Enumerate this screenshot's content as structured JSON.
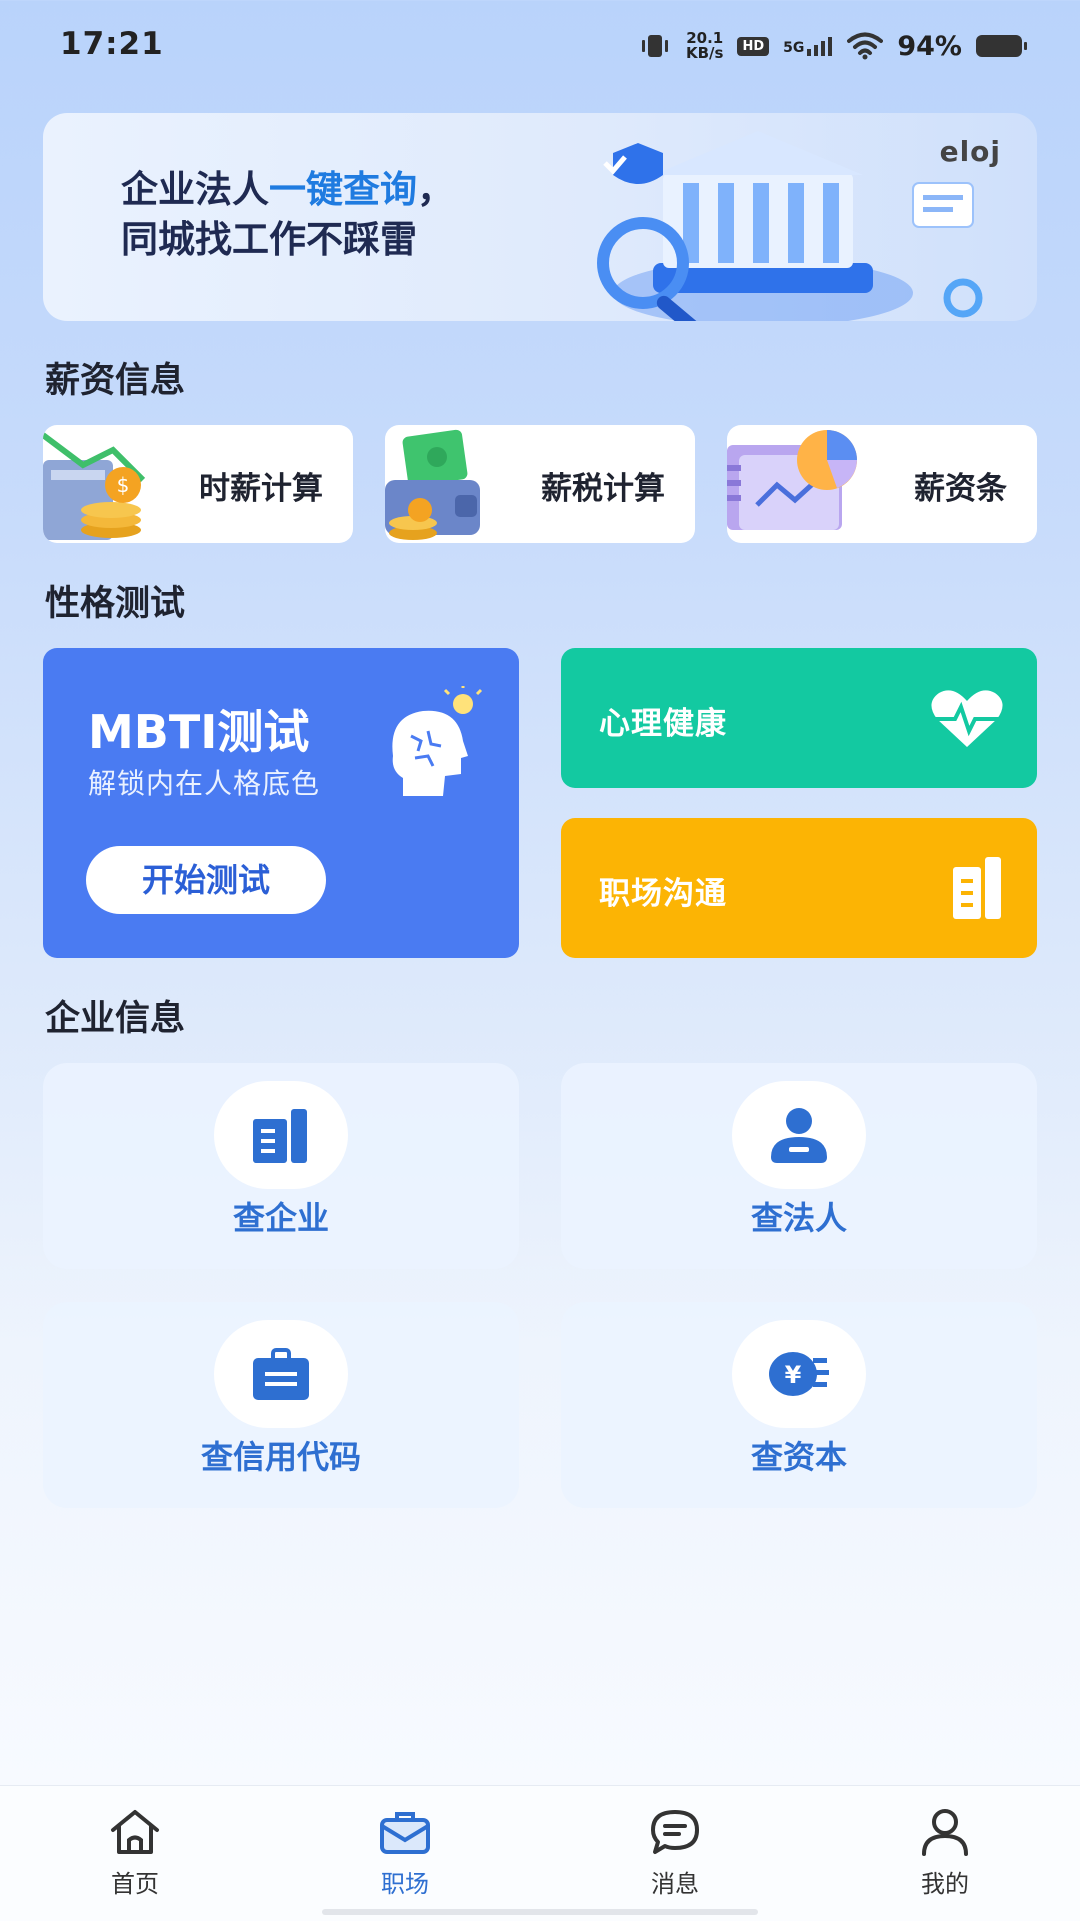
{
  "status_bar": {
    "time": "17:21",
    "net_speed_value": "20.1",
    "net_speed_unit": "KB/s",
    "hd": "HD",
    "network": "5G",
    "battery": "94%"
  },
  "banner": {
    "line1_prefix": "企业法人",
    "line1_highlight": "一键查询",
    "line1_suffix": "，",
    "line2": "同城找工作不踩雷",
    "brand": "eloj"
  },
  "salary_section": {
    "title": "薪资信息",
    "items": [
      {
        "label": "时薪计算",
        "icon": "hourly-wage-icon"
      },
      {
        "label": "薪税计算",
        "icon": "salary-tax-icon"
      },
      {
        "label": "薪资条",
        "icon": "payslip-icon"
      }
    ]
  },
  "personality_section": {
    "title": "性格测试",
    "mbti": {
      "title": "MBTI测试",
      "subtitle": "解锁内在人格底色",
      "button": "开始测试"
    },
    "mental_health": {
      "label": "心理健康",
      "color": "#13c9a1"
    },
    "workplace": {
      "label": "职场沟通",
      "color": "#fcb404"
    }
  },
  "enterprise_section": {
    "title": "企业信息",
    "items": [
      {
        "label": "查企业",
        "icon": "building-icon"
      },
      {
        "label": "查法人",
        "icon": "person-icon"
      },
      {
        "label": "查信用代码",
        "icon": "id-card-icon"
      },
      {
        "label": "查资本",
        "icon": "yuan-coin-icon"
      }
    ]
  },
  "tabbar": {
    "items": [
      {
        "label": "首页",
        "icon": "home-icon"
      },
      {
        "label": "职场",
        "icon": "briefcase-icon",
        "active": true
      },
      {
        "label": "消息",
        "icon": "message-icon"
      },
      {
        "label": "我的",
        "icon": "profile-icon"
      }
    ],
    "active_color": "#2e6fd1"
  }
}
